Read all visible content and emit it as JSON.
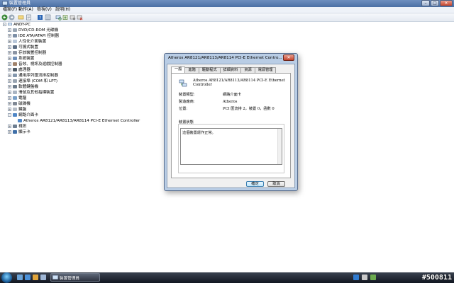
{
  "window": {
    "title": "裝置管理員",
    "min": "–",
    "max": "□",
    "close": "✕"
  },
  "menu": [
    {
      "label": "檔案(F)"
    },
    {
      "label": "動作(A)"
    },
    {
      "label": "檢視(V)"
    },
    {
      "label": "說明(H)"
    }
  ],
  "toolbar": {
    "icons": [
      "back-icon",
      "forward-icon",
      "up-icon",
      "properties-icon",
      "help-icon",
      "list-icon",
      "scan-hardware-icon",
      "update-driver-icon",
      "disable-icon",
      "uninstall-icon"
    ]
  },
  "tree": {
    "root": "ANDY-PC",
    "items": [
      {
        "label": "DVD/CD-ROM 光碟機",
        "expander": "+"
      },
      {
        "label": "IDE ATA/ATAPI 控制器",
        "expander": "+"
      },
      {
        "label": "人性化介面裝置",
        "expander": "+"
      },
      {
        "label": "可攜式裝置",
        "expander": "+"
      },
      {
        "label": "存放裝置控制器",
        "expander": "+"
      },
      {
        "label": "系統裝置",
        "expander": "+"
      },
      {
        "label": "音效、視訊及遊戲控制器",
        "expander": "+"
      },
      {
        "label": "處理器",
        "expander": "+"
      },
      {
        "label": "通用序列匯流排控制器",
        "expander": "+"
      },
      {
        "label": "連接埠 (COM 和 LPT)",
        "expander": "+"
      },
      {
        "label": "軟體鍵盤機",
        "expander": "+"
      },
      {
        "label": "滑鼠及其他指標裝置",
        "expander": "+"
      },
      {
        "label": "電腦",
        "expander": "+"
      },
      {
        "label": "磁碟機",
        "expander": "+"
      },
      {
        "label": "鍵盤",
        "expander": "+"
      },
      {
        "label": "網路介面卡",
        "expander": "–"
      },
      {
        "label": "Atheros AR8121/AR8113/AR8114 PCI-E Ethernet Controller",
        "expander": ""
      },
      {
        "label": "視訊",
        "expander": "+"
      },
      {
        "label": "顯示卡",
        "expander": "+"
      }
    ]
  },
  "dialog": {
    "title": "Atheros AR8121/AR8113/AR8114 PCI-E Ethernet Contro...",
    "close": "✕",
    "tabs": [
      {
        "label": "一般"
      },
      {
        "label": "進階"
      },
      {
        "label": "驅動程式"
      },
      {
        "label": "詳細資料"
      },
      {
        "label": "資源"
      },
      {
        "label": "電源管理"
      }
    ],
    "device_name": "Atheros AR8121/AR8113/AR8114 PCI-E Ethernet Controller",
    "props": [
      {
        "label": "裝置類型:",
        "value": "網路介面卡"
      },
      {
        "label": "製造廠商:",
        "value": "Atheros"
      },
      {
        "label": "位置:",
        "value": "PCI 匯流排 2，裝置 0，函數 0"
      }
    ],
    "status_group": "裝置狀態",
    "status_text": "這個裝置運作正常。",
    "ok": "確定",
    "cancel": "取消"
  },
  "taskbar": {
    "task_label": "裝置管理員",
    "watermark": "#500811"
  }
}
